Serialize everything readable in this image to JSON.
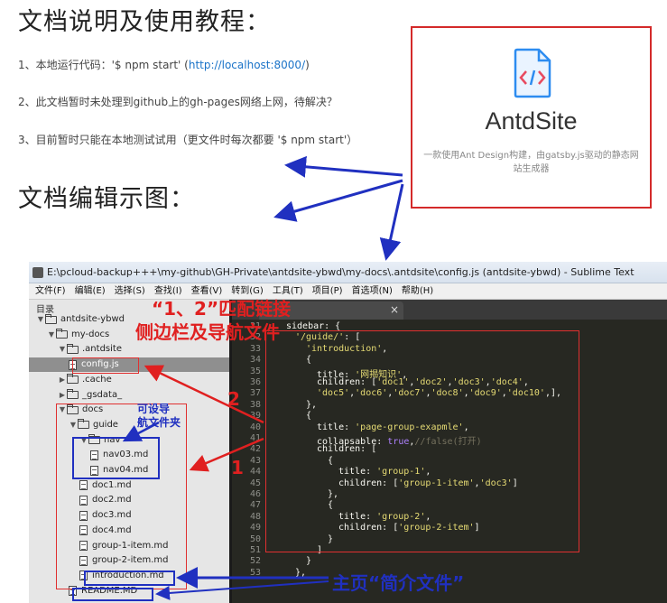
{
  "doc": {
    "heading_usage": "文档说明及使用教程：",
    "steps": [
      {
        "prefix": "1、本地运行代码：'$ npm start' (",
        "link": "http://localhost:8000/",
        "suffix": ")"
      },
      {
        "text": "2、此文档暂时未处理到github上的gh-pages网络上网，待解决？"
      },
      {
        "text": "3、目前暂时只能在本地测试试用（更文件时每次都要 '$ npm start'）"
      }
    ],
    "heading_edit": "文档编辑示图："
  },
  "card": {
    "name": "AntdSite",
    "description": "一款使用Ant Design构建，由gatsby.js驱动的静态网站生成器",
    "logo_icon": "code-file-icon",
    "accent": "#2d8cf0"
  },
  "editor_window": {
    "title": "E:\\pcloud-backup+++\\my-github\\GH-Private\\antdsite-ybwd\\my-docs\\.antdsite\\config.js (antdsite-ybwd) - Sublime Text",
    "menu": [
      "文件(F)",
      "编辑(E)",
      "选择(S)",
      "查找(I)",
      "查看(V)",
      "转到(G)",
      "工具(T)",
      "项目(P)",
      "首选项(N)",
      "帮助(H)"
    ],
    "sidebar_header": "目录",
    "tree": [
      {
        "label": "antdsite-ybwd",
        "type": "folder",
        "open": true,
        "depth": 0
      },
      {
        "label": "my-docs",
        "type": "folder",
        "open": true,
        "depth": 1
      },
      {
        "label": ".antdsite",
        "type": "folder",
        "open": true,
        "depth": 2
      },
      {
        "label": "config.js",
        "type": "file",
        "depth": 3,
        "selected": true
      },
      {
        "label": ".cache",
        "type": "folder",
        "open": false,
        "depth": 2
      },
      {
        "label": "_gsdata_",
        "type": "folder",
        "open": false,
        "depth": 2
      },
      {
        "label": "docs",
        "type": "folder",
        "open": true,
        "depth": 2
      },
      {
        "label": "guide",
        "type": "folder",
        "open": true,
        "depth": 3
      },
      {
        "label": "nav",
        "type": "folder",
        "open": true,
        "depth": 4
      },
      {
        "label": "nav03.md",
        "type": "file",
        "depth": 5
      },
      {
        "label": "nav04.md",
        "type": "file",
        "depth": 5
      },
      {
        "label": "doc1.md",
        "type": "file",
        "depth": 4
      },
      {
        "label": "doc2.md",
        "type": "file",
        "depth": 4
      },
      {
        "label": "doc3.md",
        "type": "file",
        "depth": 4
      },
      {
        "label": "doc4.md",
        "type": "file",
        "depth": 4
      },
      {
        "label": "group-1-item.md",
        "type": "file",
        "depth": 4
      },
      {
        "label": "group-2-item.md",
        "type": "file",
        "depth": 4
      },
      {
        "label": "introduction.md",
        "type": "file",
        "depth": 4
      },
      {
        "label": "README.MD",
        "type": "file",
        "depth": 3
      }
    ],
    "tab_close": "×",
    "line_numbers": [
      "31",
      "32",
      "33",
      "34",
      "35",
      "36",
      "37",
      "38",
      "39",
      "40",
      "41",
      "42",
      "43",
      "44",
      "45",
      "46",
      "47",
      "48",
      "49",
      "50",
      "51",
      "52",
      "53"
    ],
    "code_lines": [
      [
        [
          "p",
          "sidebar: {"
        ]
      ],
      [
        [
          "s",
          "'/guide/'"
        ],
        [
          "p",
          ": ["
        ]
      ],
      [
        [
          "s",
          "'introduction'"
        ],
        [
          "p",
          ","
        ]
      ],
      [
        [
          "p",
          "{"
        ]
      ],
      [
        [
          "p",
          "title: "
        ],
        [
          "s",
          "'网揭知识'"
        ],
        [
          "p",
          ","
        ]
      ],
      [
        [
          "p",
          "children: ["
        ],
        [
          "s",
          "'doc1'"
        ],
        [
          "p",
          ","
        ],
        [
          "s",
          "'doc2'"
        ],
        [
          "p",
          ","
        ],
        [
          "s",
          "'doc3'"
        ],
        [
          "p",
          ","
        ],
        [
          "s",
          "'doc4'"
        ],
        [
          "p",
          ","
        ]
      ],
      [
        [
          "s",
          "'doc5'"
        ],
        [
          "p",
          ","
        ],
        [
          "s",
          "'doc6'"
        ],
        [
          "p",
          ","
        ],
        [
          "s",
          "'doc7'"
        ],
        [
          "p",
          ","
        ],
        [
          "s",
          "'doc8'"
        ],
        [
          "p",
          ","
        ],
        [
          "s",
          "'doc9'"
        ],
        [
          "p",
          ","
        ],
        [
          "s",
          "'doc10'"
        ],
        [
          "p",
          ",],"
        ]
      ],
      [
        [
          "p",
          "},"
        ]
      ],
      [
        [
          "p",
          "{"
        ]
      ],
      [
        [
          "p",
          "title: "
        ],
        [
          "s",
          "'page-group-exapmle'"
        ],
        [
          "p",
          ","
        ]
      ],
      [
        [
          "p",
          "collapsable: "
        ],
        [
          "n",
          "true"
        ],
        [
          "p",
          ","
        ],
        [
          "c",
          "//false(打开)"
        ]
      ],
      [
        [
          "p",
          "children: ["
        ]
      ],
      [
        [
          "p",
          "{"
        ]
      ],
      [
        [
          "p",
          "title: "
        ],
        [
          "s",
          "'group-1'"
        ],
        [
          "p",
          ","
        ]
      ],
      [
        [
          "p",
          "children: ["
        ],
        [
          "s",
          "'group-1-item'"
        ],
        [
          "p",
          ","
        ],
        [
          "s",
          "'doc3'"
        ],
        [
          "p",
          "]"
        ]
      ],
      [
        [
          "p",
          "},"
        ]
      ],
      [
        [
          "p",
          "{"
        ]
      ],
      [
        [
          "p",
          "title: "
        ],
        [
          "s",
          "'group-2'"
        ],
        [
          "p",
          ","
        ]
      ],
      [
        [
          "p",
          "children: ["
        ],
        [
          "s",
          "'group-2-item'"
        ],
        [
          "p",
          "]"
        ]
      ],
      [
        [
          "p",
          "}"
        ]
      ],
      [
        [
          "p",
          "]"
        ]
      ],
      [
        [
          "p",
          "}"
        ]
      ],
      [
        [
          "p",
          "},"
        ]
      ]
    ]
  },
  "annotations": {
    "match_note_line1": "“1、2”匹配链接",
    "match_note_line2": "侧边栏及导航文件",
    "num_1": "1",
    "num_2": "2",
    "nav_note_line1": "可设导",
    "nav_note_line2": "航文件夹",
    "home_note": "主页“简介文件”",
    "red": "#e02020",
    "blue": "#2030c0"
  }
}
